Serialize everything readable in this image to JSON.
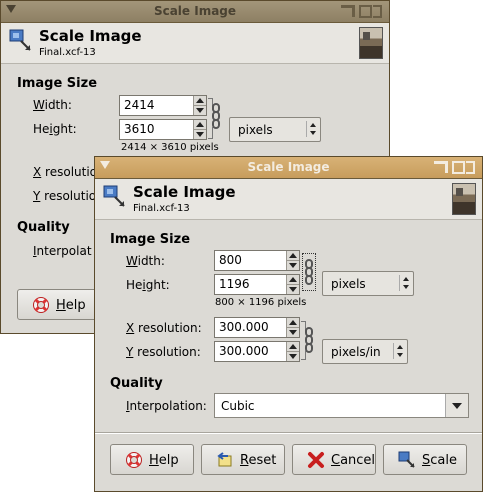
{
  "back_window": {
    "title": "Scale Image",
    "header_title": "Scale Image",
    "header_subtitle": "Final.xcf-13",
    "image_size_label": "Image Size",
    "width_label_pre": "W",
    "width_label_rest": "idth:",
    "width_value": "2414",
    "height_label_pre": "He",
    "height_label_u": "i",
    "height_label_rest": "ght:",
    "height_value": "3610",
    "size_note": "2414 × 3610 pixels",
    "unit": "pixels",
    "x_res_u": "X",
    "x_res_rest": " resolutio",
    "y_res_u": "Y",
    "y_res_rest": " resolutio",
    "quality_label": "Quality",
    "interp_u": "I",
    "interp_rest": "nterpolat",
    "help_label_u": "H",
    "help_label_rest": "elp"
  },
  "front_window": {
    "title": "Scale Image",
    "header_title": "Scale Image",
    "header_subtitle": "Final.xcf-13",
    "image_size_label": "Image Size",
    "width_label_pre": "W",
    "width_label_rest": "idth:",
    "width_value": "800",
    "height_label_pre": "He",
    "height_label_u": "i",
    "height_label_rest": "ght:",
    "height_value": "1196",
    "size_note": "800 × 1196 pixels",
    "size_unit": "pixels",
    "x_res_u": "X",
    "x_res_rest": " resolution:",
    "x_res_value": "300.000",
    "y_res_u": "Y",
    "y_res_rest": " resolution:",
    "y_res_value": "300.000",
    "res_unit": "pixels/in",
    "quality_label": "Quality",
    "interp_u": "I",
    "interp_rest": "nterpolation:",
    "interp_value": "Cubic",
    "buttons": {
      "help_u": "H",
      "help_rest": "elp",
      "reset_u": "R",
      "reset_rest": "eset",
      "cancel_u": "C",
      "cancel_rest": "ancel",
      "scale_u": "S",
      "scale_rest": "cale"
    }
  }
}
